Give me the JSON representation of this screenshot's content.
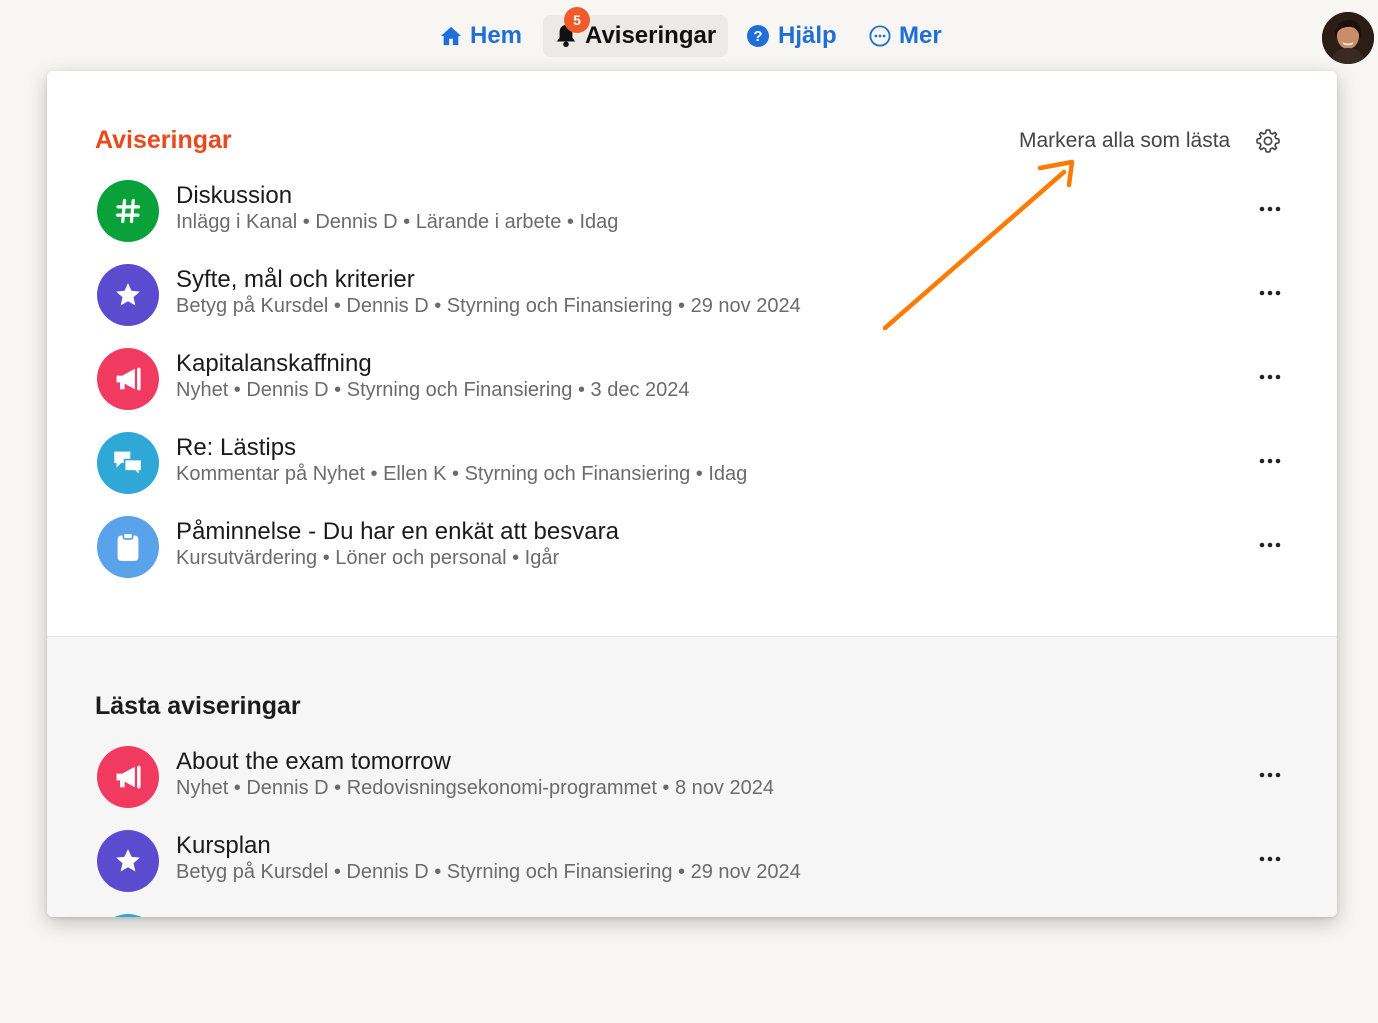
{
  "nav": {
    "home_label": "Hem",
    "notifications_label": "Aviseringar",
    "notifications_badge": "5",
    "help_label": "Hjälp",
    "more_label": "Mer"
  },
  "panel": {
    "unread_title": "Aviseringar",
    "mark_all_label": "Markera alla som lästa",
    "read_title": "Lästa aviseringar"
  },
  "unread": [
    {
      "title": "Diskussion",
      "meta": "Inlägg i Kanal • Dennis D • Lärande i arbete • Idag",
      "icon": "hashtag-icon",
      "color": "#0aa13a"
    },
    {
      "title": "Syfte, mål och kriterier",
      "meta": "Betyg på Kursdel • Dennis D • Styrning och Finansiering • 29 nov 2024",
      "icon": "star-icon",
      "color": "#5b4ccf"
    },
    {
      "title": "Kapitalanskaffning",
      "meta": "Nyhet • Dennis D • Styrning och Finansiering • 3 dec 2024",
      "icon": "megaphone-icon",
      "color": "#f03a5f"
    },
    {
      "title": "Re: Lästips",
      "meta": "Kommentar på Nyhet • Ellen K • Styrning och Finansiering • Idag",
      "icon": "chat-bubbles-icon",
      "color": "#2fa8d8"
    },
    {
      "title": "Påminnelse - Du har en enkät att besvara",
      "meta": "Kursutvärdering • Löner och personal • Igår",
      "icon": "clipboard-icon",
      "color": "#5aa2ea"
    }
  ],
  "read": [
    {
      "title": "About the exam tomorrow",
      "meta": "Nyhet • Dennis D • Redovisningsekonomi-programmet • 8 nov 2024",
      "icon": "megaphone-icon",
      "color": "#f03a5f"
    },
    {
      "title": "Kursplan",
      "meta": "Betyg på Kursdel • Dennis D • Styrning och Finansiering • 29 nov 2024",
      "icon": "star-icon",
      "color": "#5b4ccf"
    }
  ],
  "colors": {
    "accent_blue": "#1f6fd6",
    "title_orange": "#e8491d",
    "badge": "#f15a29",
    "annotation_arrow": "#ff7a00"
  }
}
